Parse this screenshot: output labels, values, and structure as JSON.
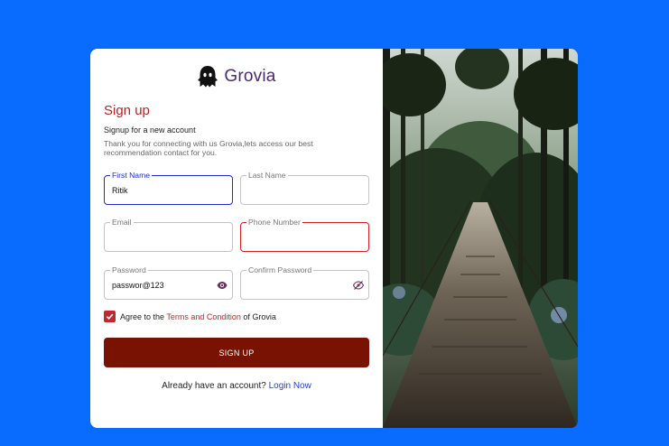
{
  "brand": {
    "name": "Grovia"
  },
  "form": {
    "title": "Sign up",
    "subtitle": "Signup for a new account",
    "description": "Thank you for connecting with us Grovia,lets access our best recommendation contact for you.",
    "fields": {
      "first_name": {
        "label": "First Name",
        "value": "Ritik"
      },
      "last_name": {
        "label": "Last Name",
        "value": ""
      },
      "email": {
        "label": "Email",
        "value": ""
      },
      "phone": {
        "label": "Phone Number",
        "value": ""
      },
      "password": {
        "label": "Password",
        "value": "passwor@123"
      },
      "confirm_password": {
        "label": "Confirm Password",
        "value": ""
      }
    },
    "agree": {
      "prefix": "Agree to the ",
      "link": "Terms and Condition",
      "suffix": " of Grovia",
      "checked": true
    },
    "signup_label": "SIGN UP",
    "login_prompt": "Already have an account? ",
    "login_link": "Login Now"
  },
  "colors": {
    "background": "#0a6cff",
    "accent": "#b3261e",
    "button": "#7a1204",
    "focus": "#1f2bd1",
    "error": "#d11f1f",
    "link": "#1f3fd1"
  }
}
